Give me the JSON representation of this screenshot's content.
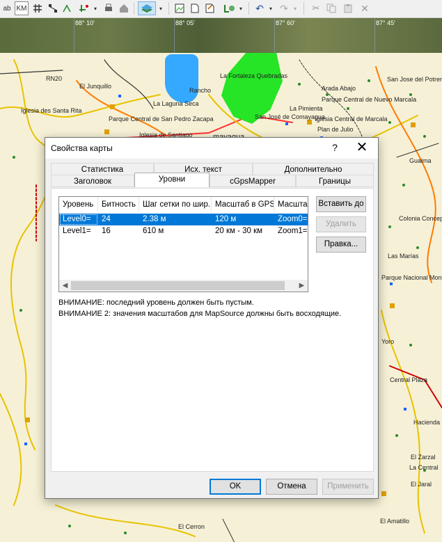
{
  "toolbar": {
    "items": [
      "ab",
      "KM",
      "grid-icon",
      "node-icon",
      "map-icon",
      "print-icon",
      "house-icon",
      "layers-icon",
      "dropdown-icon",
      "img-icon",
      "doc-icon",
      "gps-icon",
      "gear-icon",
      "undo-icon",
      "redo-icon",
      "cut-icon",
      "copy-icon",
      "paste-icon",
      "delete-icon"
    ],
    "label_ab": "ab",
    "label_km": "KM"
  },
  "map": {
    "coords": [
      "88° 10'",
      "88° 05'",
      "87° 60'",
      "87° 45'"
    ],
    "labels": [
      "RN20",
      "El Junquillo",
      "Iglesia des Santa Rita",
      "La Fortaleza Quebradas",
      "Arada Abajo",
      "Parque Central de Nuevo Marcala",
      "Iglesia Central de Marcala",
      "Parque Central de San Pedro Zacapa",
      "Rancho",
      "La Laguna Seca",
      "San José de Comayagua",
      "mayagua",
      "Iglesia de Santiago",
      "Plan de Julio",
      "Guaima",
      "Colonia Concepción",
      "Las Marías",
      "Parque Nacional Montaña",
      "El Zarzal",
      "La Central",
      "Yoro",
      "Hacienda",
      "El Cerron",
      "El Amatillo",
      "Central Plaza",
      "El Jaral",
      "La Pimienta",
      "San Jose del Potrero"
    ]
  },
  "dialog": {
    "title": "Свойства карты",
    "help": "?",
    "close": "✕",
    "tabs_back": [
      "Статистика",
      "Исх. текст",
      "Дополнительно"
    ],
    "tabs_front": [
      "Заголовок",
      "Уровни",
      "cGpsMapper",
      "Границы"
    ],
    "selected_tab": "Уровни",
    "list": {
      "headers": [
        "Уровень",
        "Битность",
        "Шаг сетки по шир.",
        "Масштаб в GPS",
        "Масштаб"
      ],
      "rows": [
        [
          "Level0=",
          "24",
          "2.38 м",
          "120 м",
          "Zoom0="
        ],
        [
          "Level1=",
          "16",
          "610 м",
          "20 км - 30 км",
          "Zoom1="
        ]
      ],
      "selected_row": 0
    },
    "side_buttons": {
      "insert": "Вставить до",
      "delete": "Удалить",
      "edit": "Правка..."
    },
    "warnings": [
      "ВНИМАНИЕ: последний уровень должен быть пустым.",
      "ВНИМАНИЕ 2: значения масштабов для MapSource должны быть восходящие."
    ],
    "footer": {
      "ok": "OK",
      "cancel": "Отмена",
      "apply": "Применить"
    }
  },
  "colors": {
    "selection": "#0078d7",
    "lake": "#35a8ff",
    "park": "#26e426",
    "map_bg": "#f6f1d6"
  }
}
